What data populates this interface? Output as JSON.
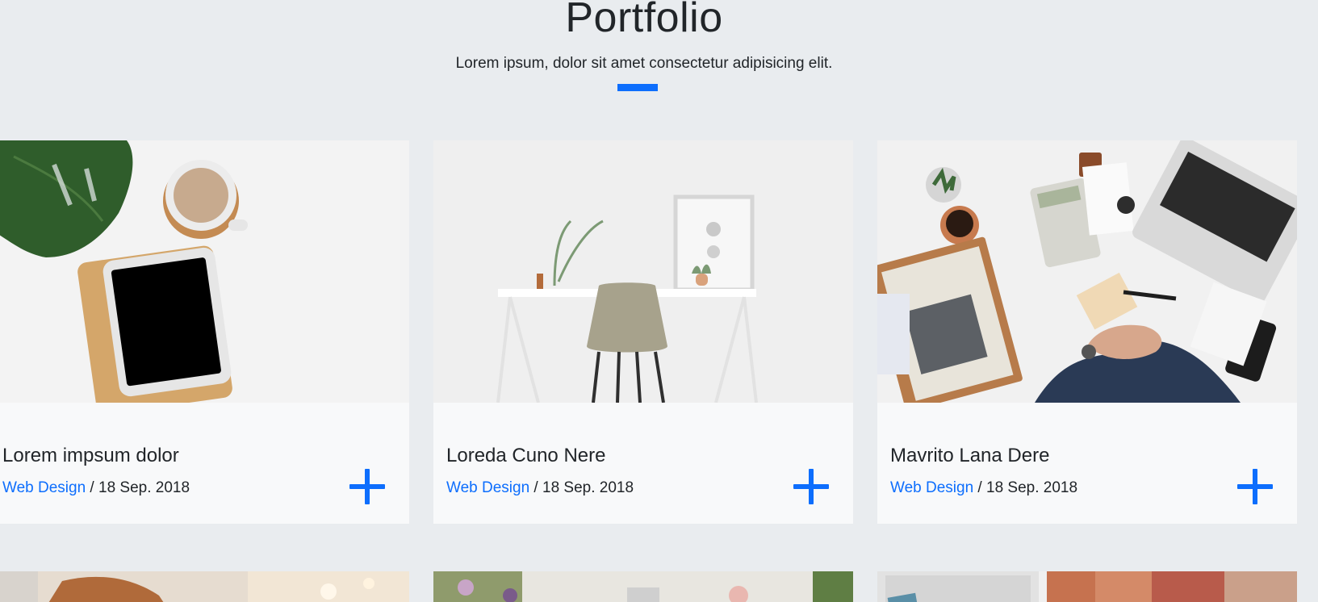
{
  "section": {
    "title": "Portfolio",
    "subtitle": "Lorem ipsum, dolor sit amet consectetur adipisicing elit."
  },
  "accent_color": "#0d6efd",
  "cards": [
    {
      "title": "Lorem impsum dolor",
      "category": "Web Design",
      "separator": " / ",
      "date": "18 Sep. 2018",
      "image": "desk-with-plant-coffee-tablet"
    },
    {
      "title": "Loreda Cuno Nere",
      "category": "Web Design",
      "separator": " / ",
      "date": "18 Sep. 2018",
      "image": "white-desk-chair-frame"
    },
    {
      "title": "Mavrito Lana Dere",
      "category": "Web Design",
      "separator": " / ",
      "date": "18 Sep. 2018",
      "image": "business-desk-laptop-newspaper"
    }
  ],
  "row2_images": [
    "brown-bag-laptop",
    "flowers-table",
    "keyboard-books"
  ]
}
